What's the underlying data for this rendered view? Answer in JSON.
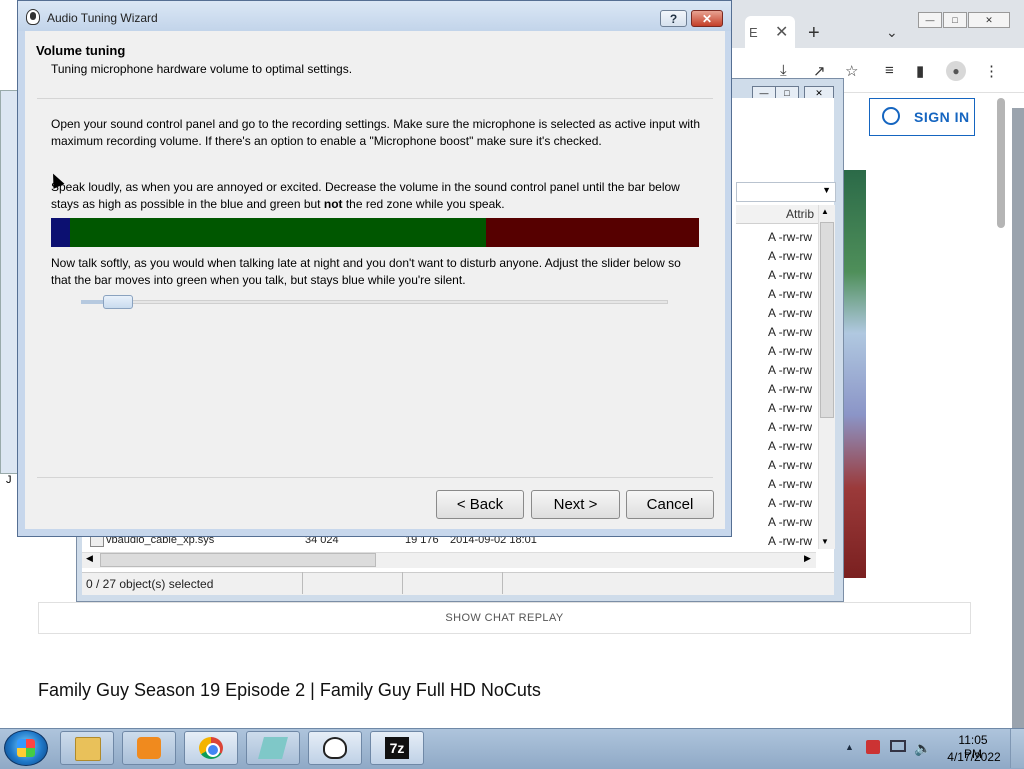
{
  "wizard": {
    "title": "Audio Tuning Wizard",
    "help_label": "?",
    "close_label": "✕",
    "heading": "Volume tuning",
    "subheading": "Tuning microphone hardware volume to optimal settings.",
    "para1": "Open your sound control panel and go to the recording settings. Make sure the microphone is selected as active input with maximum recording volume. If there's an option to enable a \"Microphone boost\" make sure it's checked.",
    "para2_before": "Speak loudly, as when you are annoyed or excited. Decrease the volume in the sound control panel until the bar below stays as high as possible in the blue and green but ",
    "para2_bold": "not",
    "para2_after": " the red zone while you speak.",
    "para3": "Now talk softly, as you would when talking late at night and you don't want to disturb anyone. Adjust the slider below so that the bar moves into green when you talk, but stays blue while you're silent.",
    "meter_colors": {
      "blue": "#0c1071",
      "green": "#005700",
      "red": "#560000"
    },
    "slider_value_fraction": 0.04,
    "buttons": {
      "back": "< Back",
      "next": "Next >",
      "cancel": "Cancel"
    }
  },
  "browser": {
    "tab_partial": "E",
    "tab_close": "✕",
    "new_tab": "+",
    "tab_dropdown": "⌄",
    "sign_in": "SIGN IN",
    "chat_replay": "SHOW CHAT REPLAY",
    "video_title": "Family Guy Season 19 Episode 2 | Family Guy Full HD NoCuts",
    "window_buttons": [
      "—",
      "□",
      "✕"
    ],
    "toolbar_icons": [
      "download-icon",
      "share-icon",
      "star-icon",
      "reading-list-icon",
      "sidebar-icon",
      "profile-icon",
      "menu-icon"
    ]
  },
  "file_manager": {
    "window_buttons": [
      "—",
      "□",
      "✕"
    ],
    "attrib_header": "Attrib",
    "attrib_values": [
      "A -rw-rw",
      "A -rw-rw",
      "A -rw-rw",
      "A -rw-rw",
      "A -rw-rw",
      "A -rw-rw",
      "A -rw-rw",
      "A -rw-rw",
      "A -rw-rw",
      "A -rw-rw",
      "A -rw-rw",
      "A -rw-rw",
      "A -rw-rw",
      "A -rw-rw",
      "A -rw-rw",
      "A -rw-rw",
      "A -rw-rw"
    ],
    "bottom_row": {
      "name": "vbaudio_cable_xp.sys",
      "size": "34 024",
      "packed": "19 176",
      "modified": "2014-09-02 18:01"
    },
    "status": "0 / 27 object(s) selected"
  },
  "stub_window": {
    "label": "J"
  },
  "taskbar": {
    "apps": [
      "file-explorer-icon",
      "media-player-icon",
      "chrome-icon",
      "notepad-icon",
      "mumble-icon",
      "7zip-icon"
    ],
    "seven_zip_label": "7z",
    "tray_icons": [
      "show-hidden-icons",
      "action-center-icon",
      "network-icon",
      "volume-icon"
    ],
    "tray_up": "▲",
    "time": "11:05 PM",
    "date": "4/17/2022"
  }
}
